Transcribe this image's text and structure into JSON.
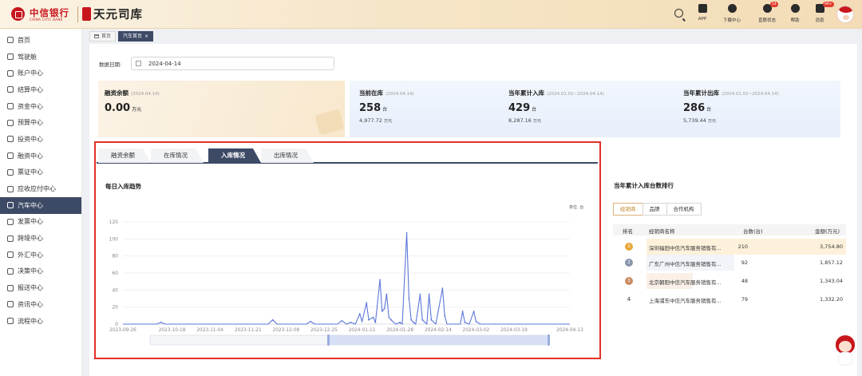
{
  "header": {
    "bank_name": "中信银行",
    "bank_name_en": "CHINA CITIC BANK",
    "product_name": "天元司库",
    "icons": [
      {
        "name": "app-icon",
        "label": "APP",
        "badge": ""
      },
      {
        "name": "download-center-icon",
        "label": "下载中心",
        "badge": ""
      },
      {
        "name": "direct-link-status-icon",
        "label": "直联状态",
        "badge": "14"
      },
      {
        "name": "help-icon",
        "label": "帮助",
        "badge": ""
      },
      {
        "name": "message-icon",
        "label": "消息",
        "badge": "99+"
      }
    ]
  },
  "sidebar": {
    "items": [
      {
        "label": "首页",
        "icon": "home-icon"
      },
      {
        "label": "驾驶舱",
        "icon": "cockpit-icon"
      },
      {
        "label": "账户中心",
        "icon": "account-icon"
      },
      {
        "label": "结算中心",
        "icon": "settlement-icon"
      },
      {
        "label": "资金中心",
        "icon": "funds-icon"
      },
      {
        "label": "预算中心",
        "icon": "budget-icon"
      },
      {
        "label": "投资中心",
        "icon": "investment-icon"
      },
      {
        "label": "融资中心",
        "icon": "financing-icon"
      },
      {
        "label": "票证中心",
        "icon": "bill-icon"
      },
      {
        "label": "应收应付中心",
        "icon": "receivable-icon"
      },
      {
        "label": "汽车中心",
        "icon": "car-icon",
        "active": true
      },
      {
        "label": "发票中心",
        "icon": "invoice-icon"
      },
      {
        "label": "跨境中心",
        "icon": "cross-border-icon"
      },
      {
        "label": "外汇中心",
        "icon": "forex-icon"
      },
      {
        "label": "决策中心",
        "icon": "decision-icon"
      },
      {
        "label": "报送中心",
        "icon": "report-icon"
      },
      {
        "label": "资讯中心",
        "icon": "news-icon"
      },
      {
        "label": "流程中心",
        "icon": "workflow-icon"
      }
    ]
  },
  "tabs": {
    "home": "首页",
    "current": "汽车首页",
    "close": "×"
  },
  "filter": {
    "date_label": "数据日期:",
    "date_value": "2024-04-14"
  },
  "cards": {
    "balance": {
      "title": "融资余额",
      "date": "(2024.04.14)",
      "value": "0.00",
      "unit": "万元"
    },
    "current_stock": {
      "title": "当前在库",
      "date": "(2024.04.14)",
      "value": "258",
      "unit": "台",
      "sub_value": "4,977.72",
      "sub_unit": "万元"
    },
    "year_in": {
      "title": "当年累计入库",
      "date": "(2024.01.01~2024.04.14)",
      "value": "429",
      "unit": "台",
      "sub_value": "8,287.16",
      "sub_unit": "万元"
    },
    "year_out": {
      "title": "当年累计出库",
      "date": "(2024.01.01~2024.04.14)",
      "value": "286",
      "unit": "台",
      "sub_value": "5,739.44",
      "sub_unit": "万元"
    }
  },
  "sub_tabs": [
    "融资余额",
    "在库情况",
    "入库情况",
    "出库情况"
  ],
  "sub_tab_active": "入库情况",
  "chart": {
    "title": "每日入库趋势",
    "unit_label": "单位: 台"
  },
  "chart_data": {
    "type": "line",
    "title": "每日入库趋势",
    "xlabel": "",
    "ylabel": "",
    "unit": "单位: 台",
    "ylim": [
      0,
      120
    ],
    "yticks": [
      0,
      20,
      40,
      60,
      80,
      100,
      120
    ],
    "xtick_labels": [
      "2023-09-26",
      "2023-10-18",
      "2023-11-04",
      "2023-11-21",
      "2023-12-08",
      "2023-12-25",
      "2024-01-11",
      "2024-01-28",
      "2024-02-14",
      "2024-03-02",
      "2024-03-19",
      "2024-04-13"
    ],
    "grid": true,
    "color": "#5b76d8",
    "series": [
      {
        "name": "",
        "points": [
          [
            "2023-09-26",
            0
          ],
          [
            "2023-10-11",
            0
          ],
          [
            "2023-10-13",
            2
          ],
          [
            "2023-10-15",
            0
          ],
          [
            "2023-11-30",
            0
          ],
          [
            "2023-12-02",
            5
          ],
          [
            "2023-12-04",
            0
          ],
          [
            "2023-12-17",
            0
          ],
          [
            "2023-12-19",
            3
          ],
          [
            "2023-12-21",
            0
          ],
          [
            "2023-12-31",
            0
          ],
          [
            "2024-01-02",
            4
          ],
          [
            "2024-01-04",
            0
          ],
          [
            "2024-01-06",
            2
          ],
          [
            "2024-01-08",
            0
          ],
          [
            "2024-01-10",
            12
          ],
          [
            "2024-01-11",
            3
          ],
          [
            "2024-01-13",
            25
          ],
          [
            "2024-01-14",
            5
          ],
          [
            "2024-01-16",
            8
          ],
          [
            "2024-01-17",
            2
          ],
          [
            "2024-01-19",
            52
          ],
          [
            "2024-01-20",
            15
          ],
          [
            "2024-01-21",
            18
          ],
          [
            "2024-01-22",
            35
          ],
          [
            "2024-01-23",
            8
          ],
          [
            "2024-01-24",
            5
          ],
          [
            "2024-01-26",
            0
          ],
          [
            "2024-01-28",
            2
          ],
          [
            "2024-01-29",
            0
          ],
          [
            "2024-01-31",
            107
          ],
          [
            "2024-02-01",
            30
          ],
          [
            "2024-02-02",
            5
          ],
          [
            "2024-02-03",
            2
          ],
          [
            "2024-02-04",
            0
          ],
          [
            "2024-02-06",
            35
          ],
          [
            "2024-02-07",
            5
          ],
          [
            "2024-02-09",
            0
          ],
          [
            "2024-02-10",
            35
          ],
          [
            "2024-02-11",
            5
          ],
          [
            "2024-02-13",
            0
          ],
          [
            "2024-02-16",
            42
          ],
          [
            "2024-02-17",
            10
          ],
          [
            "2024-02-18",
            0
          ],
          [
            "2024-02-20",
            0
          ],
          [
            "2024-02-24",
            0
          ],
          [
            "2024-02-25",
            15
          ],
          [
            "2024-02-26",
            2
          ],
          [
            "2024-02-28",
            0
          ],
          [
            "2024-03-01",
            15
          ],
          [
            "2024-03-02",
            3
          ],
          [
            "2024-03-04",
            0
          ],
          [
            "2024-04-13",
            0
          ]
        ]
      }
    ]
  },
  "ranking": {
    "title": "当年累计入库台数排行",
    "tabs": [
      "经销商",
      "品牌",
      "合作机构"
    ],
    "active_tab": "经销商",
    "headers": {
      "rank": "排名",
      "name": "经销商名称",
      "count": "台数(台)",
      "amount": "金额(万元)"
    },
    "rows": [
      {
        "rank": "1",
        "name": "深圳福田中信汽车服务销售有...",
        "count": "210",
        "amount": "3,754.80",
        "color": "#e8a93a",
        "bar_color": "#fbe6bd",
        "share": 1.0
      },
      {
        "rank": "2",
        "name": "广东广州中信汽车服务销售有...",
        "count": "92",
        "amount": "1,857.12",
        "color": "#8a96ad",
        "bar_color": "#e6ebf3",
        "share": 0.44
      },
      {
        "rank": "3",
        "name": "北京朝阳中信汽车服务销售有...",
        "count": "48",
        "amount": "1,343.04",
        "color": "#c98d61",
        "bar_color": "#f5e3d3",
        "share": 0.23
      },
      {
        "rank": "4",
        "name": "上海浦东中信汽车服务销售有...",
        "count": "79",
        "amount": "1,332.20",
        "color": "",
        "bar_color": "",
        "share": 0
      }
    ]
  },
  "colors": {
    "brand_red": "#c8161d",
    "nav_active": "#3d4a66",
    "line": "#5b76d8",
    "highlight_frame": "#e23127"
  }
}
